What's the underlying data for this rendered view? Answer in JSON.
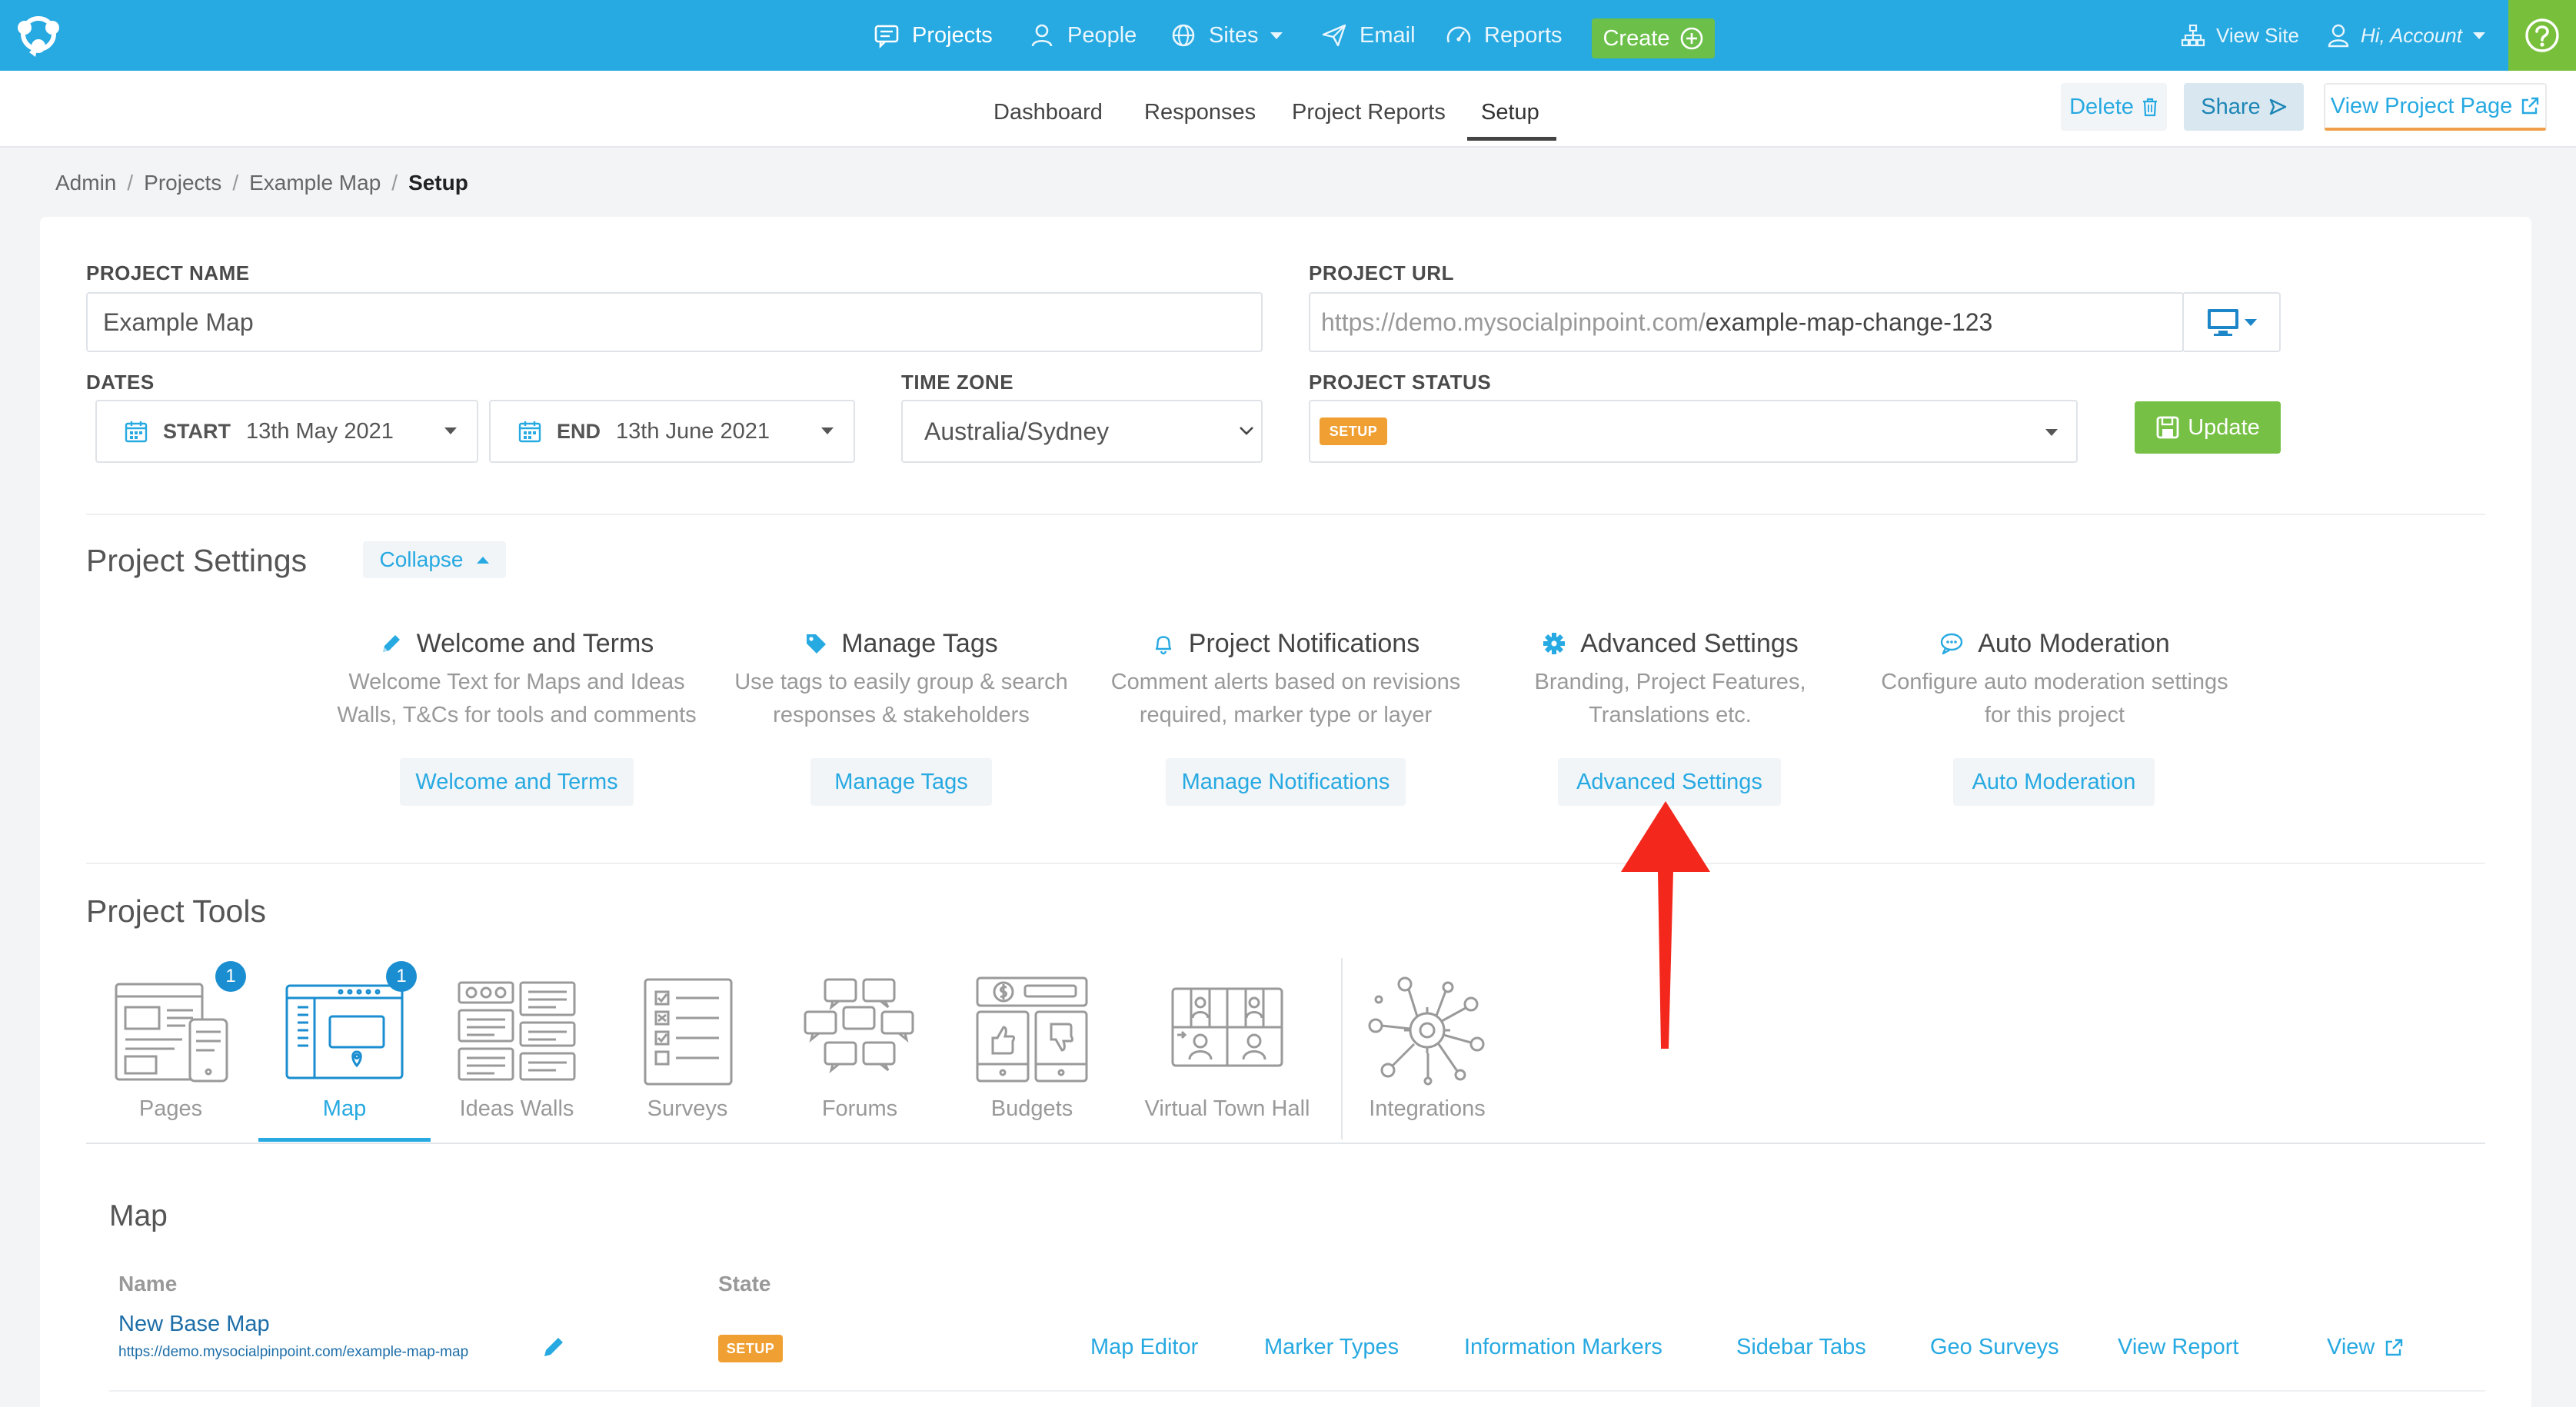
{
  "topnav": {
    "items": [
      {
        "label": "Projects",
        "icon": "chat-icon"
      },
      {
        "label": "People",
        "icon": "user-icon"
      },
      {
        "label": "Sites",
        "icon": "globe-icon"
      },
      {
        "label": "Email",
        "icon": "paper-plane-icon"
      },
      {
        "label": "Reports",
        "icon": "gauge-icon"
      }
    ],
    "create_label": "Create",
    "view_site_label": "View Site",
    "account_label": "Hi, Account"
  },
  "subnav": {
    "tabs": [
      "Dashboard",
      "Responses",
      "Project Reports",
      "Setup"
    ],
    "active_tab": "Setup",
    "delete_label": "Delete",
    "share_label": "Share",
    "view_project_label": "View Project Page"
  },
  "breadcrumb": [
    "Admin",
    "Projects",
    "Example Map",
    "Setup"
  ],
  "form": {
    "project_name_label": "PROJECT NAME",
    "project_name_value": "Example Map",
    "project_url_label": "PROJECT URL",
    "project_url_prefix": "https://demo.mysocialpinpoint.com/",
    "project_url_slug": "example-map-change-123",
    "dates_label": "DATES",
    "start_label": "START",
    "start_value": "13th May 2021",
    "end_label": "END",
    "end_value": "13th June 2021",
    "timezone_label": "TIME ZONE",
    "timezone_value": "Australia/Sydney",
    "status_label": "PROJECT STATUS",
    "status_value": "SETUP",
    "update_label": "Update"
  },
  "settings": {
    "title": "Project Settings",
    "collapse_label": "Collapse",
    "items": [
      {
        "title": "Welcome and Terms",
        "desc1": "Welcome Text for Maps and Ideas",
        "desc2": "Walls, T&Cs for tools and comments",
        "button": "Welcome and Terms",
        "icon": "pencil-icon"
      },
      {
        "title": "Manage Tags",
        "desc1": "Use tags to easily group & search",
        "desc2": "responses & stakeholders",
        "button": "Manage Tags",
        "icon": "tag-icon"
      },
      {
        "title": "Project Notifications",
        "desc1": "Comment alerts based on revisions",
        "desc2": "required, marker type or layer",
        "button": "Manage Notifications",
        "icon": "bell-icon"
      },
      {
        "title": "Advanced Settings",
        "desc1": "Branding, Project Features,",
        "desc2": "Translations etc.",
        "button": "Advanced Settings",
        "icon": "gear-icon"
      },
      {
        "title": "Auto Moderation",
        "desc1": "Configure auto moderation settings",
        "desc2": "for this project",
        "button": "Auto Moderation",
        "icon": "speech-bubble-icon"
      }
    ]
  },
  "tools": {
    "title": "Project Tools",
    "items": [
      {
        "label": "Pages",
        "badge": "1"
      },
      {
        "label": "Map",
        "badge": "1"
      },
      {
        "label": "Ideas Walls",
        "badge": ""
      },
      {
        "label": "Surveys",
        "badge": ""
      },
      {
        "label": "Forums",
        "badge": ""
      },
      {
        "label": "Budgets",
        "badge": ""
      },
      {
        "label": "Virtual Town Hall",
        "badge": ""
      },
      {
        "label": "Integrations",
        "badge": ""
      }
    ],
    "active": "Map"
  },
  "map_section": {
    "title": "Map",
    "col_name": "Name",
    "col_state": "State",
    "row": {
      "name": "New Base Map",
      "url": "https://demo.mysocialpinpoint.com/example-map-map",
      "state": "SETUP",
      "links": [
        "Map Editor",
        "Marker Types",
        "Information Markers",
        "Sidebar Tabs",
        "Geo Surveys",
        "View Report",
        "View"
      ]
    }
  },
  "colors": {
    "brand_blue": "#27a9e1",
    "create_green": "#6cc04a",
    "setup_orange": "#f0a033",
    "annotation_red": "#f3271c"
  }
}
